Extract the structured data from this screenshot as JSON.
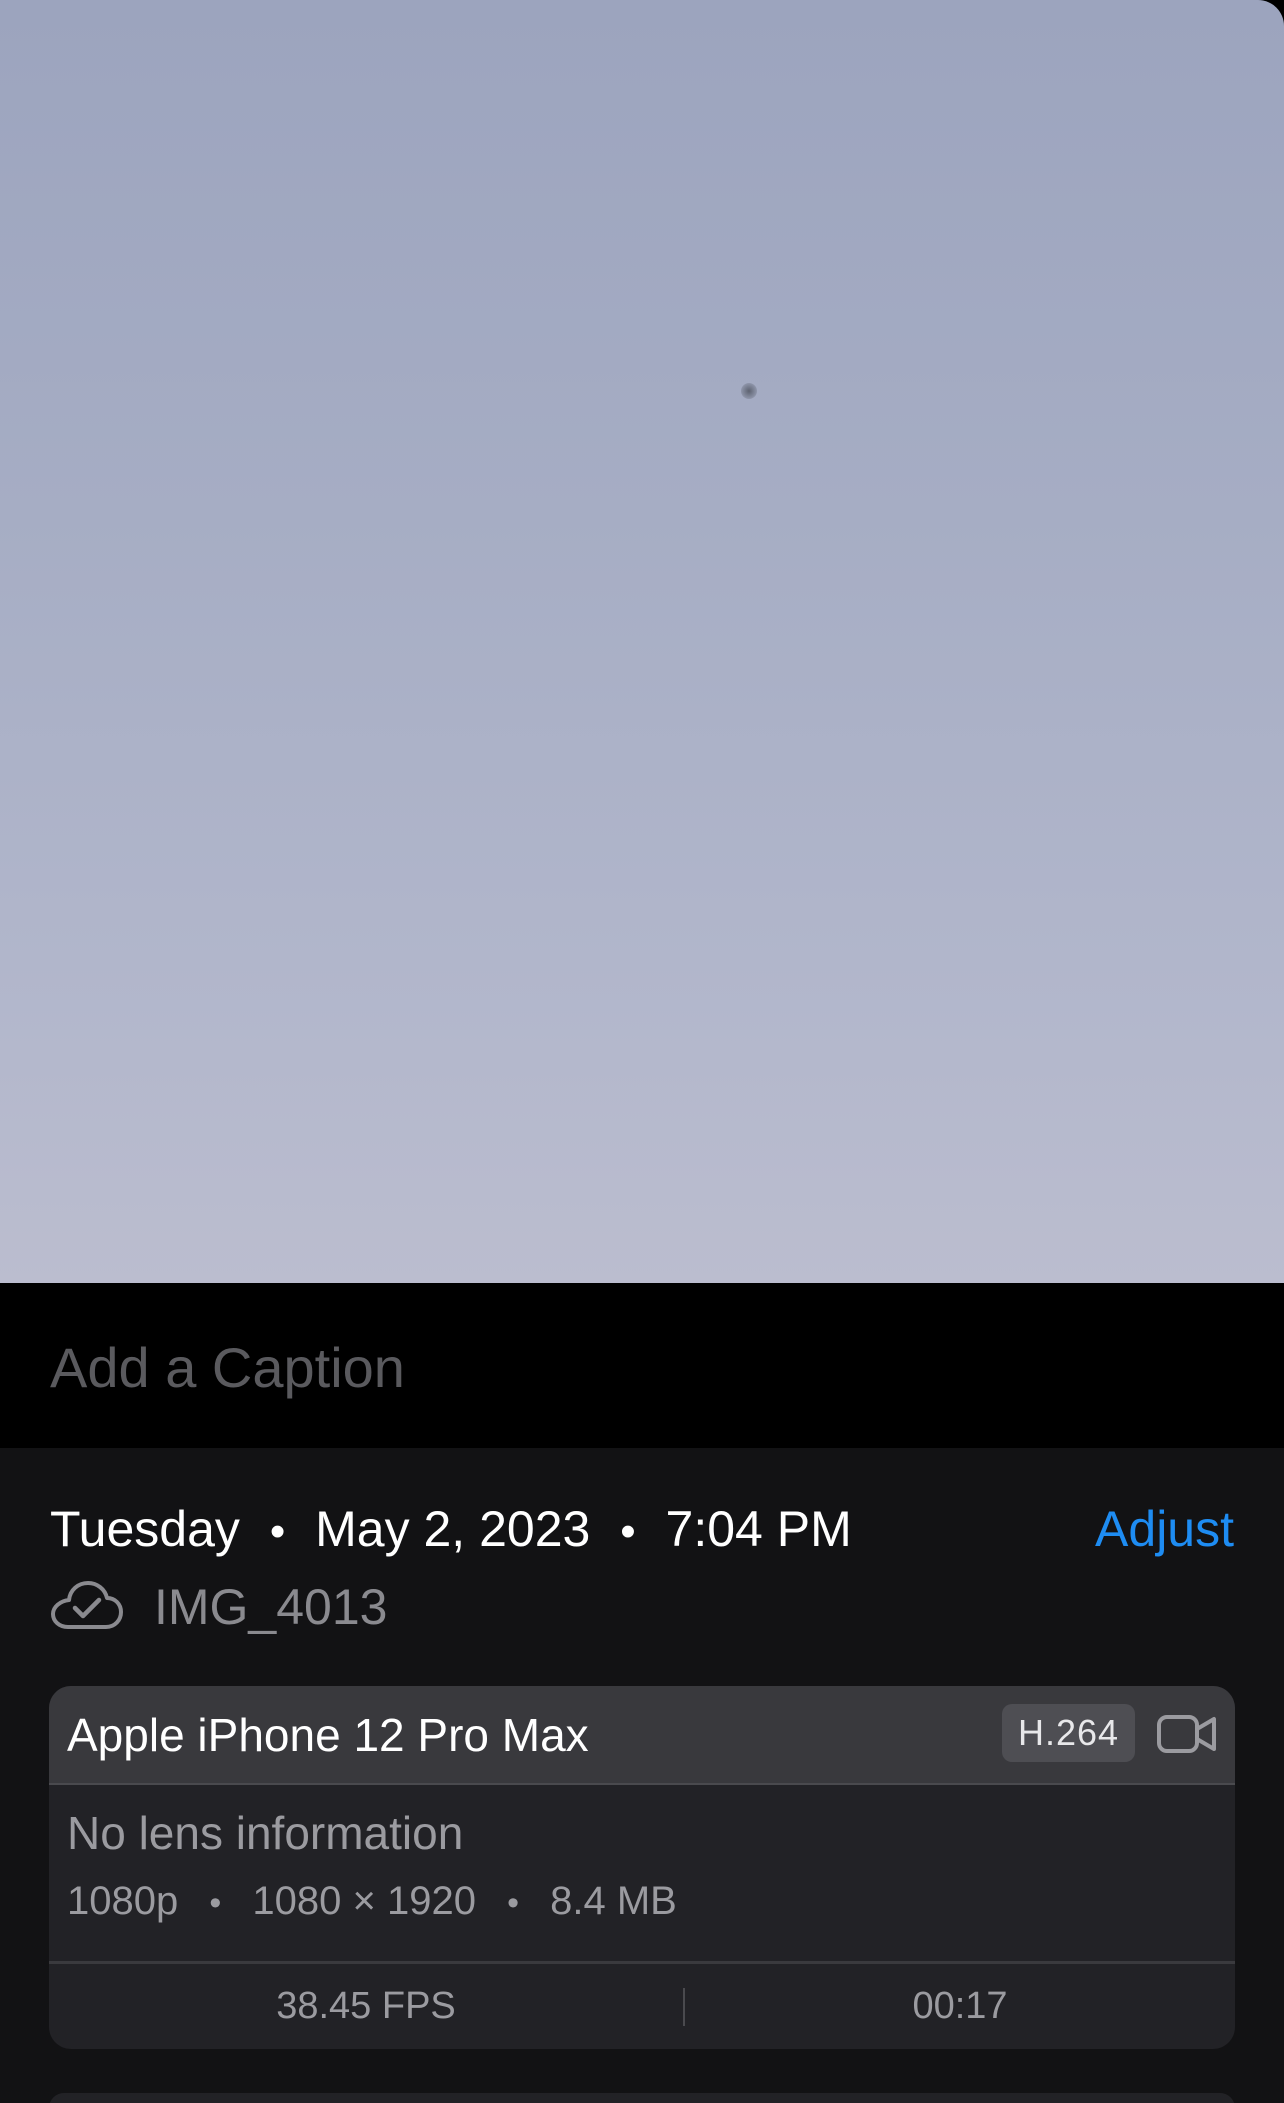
{
  "photo": {
    "description_icon": "photo-viewer",
    "colors": {
      "sky_top": "#9ca4be",
      "sky_bottom": "#bbbdcf"
    }
  },
  "caption": {
    "placeholder": "Add a Caption"
  },
  "info": {
    "weekday": "Tuesday",
    "date": "May 2, 2023",
    "time": "7:04 PM",
    "separator": "•",
    "adjust_label": "Adjust",
    "file_icon": "cloud-check-icon",
    "file_name": "IMG_4013"
  },
  "device": {
    "name": "Apple iPhone 12 Pro Max",
    "codec": "H.264",
    "media_icon": "video-camera-icon",
    "lens": "No lens information",
    "resolution_label": "1080p",
    "dimensions": "1080 × 1920",
    "file_size": "8.4 MB",
    "spec_separator": "•",
    "fps": "38.45 FPS",
    "duration": "00:17"
  },
  "colors": {
    "accent": "#1e8cf2",
    "panel_background": "#121214",
    "card_background": "#222226",
    "card_header": "#39393d"
  }
}
